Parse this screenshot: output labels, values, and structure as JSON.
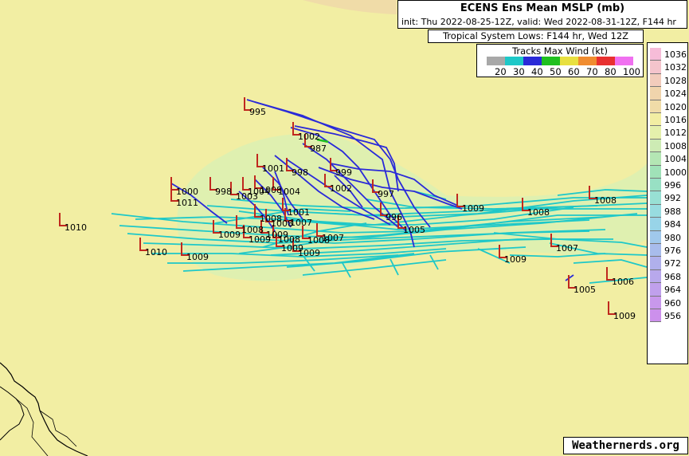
{
  "header": {
    "title": "ECENS Ens Mean MSLP (mb)",
    "subtitle": "init: Thu 2022-08-25-12Z, valid: Wed 2022-08-31-12Z, F144 hr",
    "lows_title": "Tropical System Lows: F144 hr, Wed 12Z",
    "wind_legend_title": "Tracks Max Wind (kt)"
  },
  "wind_legend": [
    {
      "label": "20",
      "color": "#a8a8a8"
    },
    {
      "label": "30",
      "color": "#1ec8c8"
    },
    {
      "label": "40",
      "color": "#2a2ad8"
    },
    {
      "label": "50",
      "color": "#20c020"
    },
    {
      "label": "60",
      "color": "#e8e040"
    },
    {
      "label": "70",
      "color": "#f08c30"
    },
    {
      "label": "80",
      "color": "#e83030"
    },
    {
      "label": "100",
      "color": "#f070f0"
    }
  ],
  "colorbar": [
    {
      "label": "1036",
      "color": "#f6bcd8"
    },
    {
      "label": "1032",
      "color": "#f4c4cc"
    },
    {
      "label": "1028",
      "color": "#f2ccbc"
    },
    {
      "label": "1024",
      "color": "#f0d4ac"
    },
    {
      "label": "1020",
      "color": "#f0dca8"
    },
    {
      "label": "1016",
      "color": "#f2eea3"
    },
    {
      "label": "1012",
      "color": "#e4f0ac"
    },
    {
      "label": "1008",
      "color": "#cdebb4"
    },
    {
      "label": "1004",
      "color": "#b4e6b4"
    },
    {
      "label": "1000",
      "color": "#a0e2b8"
    },
    {
      "label": "996",
      "color": "#98e0c4"
    },
    {
      "label": "992",
      "color": "#98e0d4"
    },
    {
      "label": "988",
      "color": "#98dce0"
    },
    {
      "label": "984",
      "color": "#98d4e8"
    },
    {
      "label": "980",
      "color": "#a0c8ec"
    },
    {
      "label": "976",
      "color": "#a8bcec"
    },
    {
      "label": "972",
      "color": "#b0b0ec"
    },
    {
      "label": "968",
      "color": "#b8a8ec"
    },
    {
      "label": "964",
      "color": "#c0a0ec"
    },
    {
      "label": "960",
      "color": "#c898ec"
    },
    {
      "label": "956",
      "color": "#cc90ec"
    }
  ],
  "lows": [
    {
      "label": "995"
    },
    {
      "label": "1002"
    },
    {
      "label": "987"
    },
    {
      "label": "1001"
    },
    {
      "label": "998"
    },
    {
      "label": "999"
    },
    {
      "label": "1000"
    },
    {
      "label": "998"
    },
    {
      "label": "1004"
    },
    {
      "label": "1002"
    },
    {
      "label": "997"
    },
    {
      "label": "1011"
    },
    {
      "label": "1003"
    },
    {
      "label": "1008"
    },
    {
      "label": "1004"
    },
    {
      "label": "1001"
    },
    {
      "label": "1009"
    },
    {
      "label": "1008"
    },
    {
      "label": "1010"
    },
    {
      "label": "1008"
    },
    {
      "label": "1009"
    },
    {
      "label": "1009"
    },
    {
      "label": "1007"
    },
    {
      "label": "996"
    },
    {
      "label": "1005"
    },
    {
      "label": "1008"
    },
    {
      "label": "1007"
    },
    {
      "label": "1008"
    },
    {
      "label": "1009"
    },
    {
      "label": "1008"
    },
    {
      "label": "1009"
    },
    {
      "label": "1009"
    },
    {
      "label": "1008"
    },
    {
      "label": "1010"
    },
    {
      "label": "1009"
    },
    {
      "label": "1007"
    },
    {
      "label": "1005"
    },
    {
      "label": "1006"
    },
    {
      "label": "1009"
    },
    {
      "label": "1008"
    },
    {
      "label": "1009"
    }
  ],
  "brand": "Weathernerds.org",
  "colors": {
    "land_bg": "#f2eea3",
    "low_pressure_shade": "#dff0b0",
    "low_marker": "#c0281e",
    "track_30kt": "#1ec8c8",
    "track_40kt": "#2a2ad8",
    "track_50kt": "#20c020"
  }
}
